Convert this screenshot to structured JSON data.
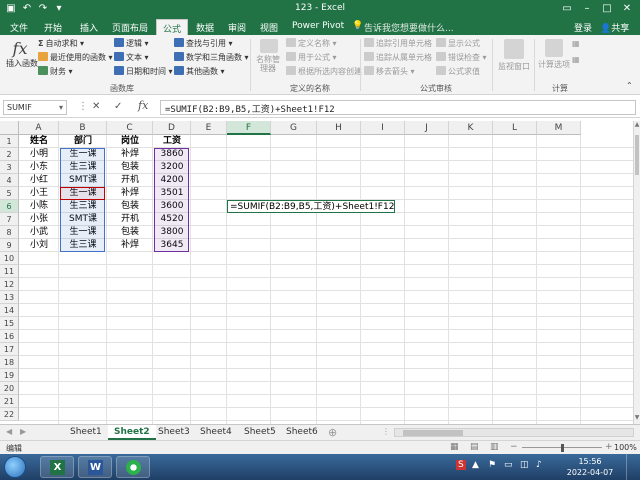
{
  "window": {
    "title": "123 - Excel"
  },
  "tabs": [
    "文件",
    "开始",
    "插入",
    "页面布局",
    "公式",
    "数据",
    "审阅",
    "视图",
    "Power Pivot"
  ],
  "active_tab": "公式",
  "tell_me": "告诉我您想要做什么...",
  "account": {
    "login": "登录",
    "share": "共享"
  },
  "ribbon": {
    "insert_function": "插入函数",
    "autosum": "自动求和",
    "recent": "最近使用的函数",
    "financial": "财务",
    "logical": "逻辑",
    "text": "文本",
    "datetime": "日期和时间",
    "lookup": "查找与引用",
    "math": "数学和三角函数",
    "more": "其他函数",
    "group_library": "函数库",
    "name_manager": "名称管理器",
    "define_name": "定义名称",
    "use_in_formula": "用于公式",
    "create_from_sel": "根据所选内容创建",
    "group_names": "定义的名称",
    "trace_precedents": "追踪引用单元格",
    "trace_dependents": "追踪从属单元格",
    "remove_arrows": "移去箭头",
    "show_formulas": "显示公式",
    "error_check": "错误检查",
    "evaluate": "公式求值",
    "group_audit": "公式审核",
    "watch": "监视窗口",
    "calc_options": "计算选项",
    "group_calc": "计算"
  },
  "formula_bar": {
    "name_box": "SUMIF",
    "formula": "=SUMIF(B2:B9,B5,工资)+Sheet1!F12"
  },
  "columns": [
    "A",
    "B",
    "C",
    "D",
    "E",
    "F",
    "G",
    "H",
    "I",
    "J",
    "K",
    "L",
    "M"
  ],
  "rows": [
    "1",
    "2",
    "3",
    "4",
    "5",
    "6",
    "7",
    "8",
    "9",
    "10",
    "11",
    "12",
    "13",
    "14",
    "15",
    "16",
    "17",
    "18",
    "19",
    "20",
    "21",
    "22"
  ],
  "table": {
    "headers": [
      "姓名",
      "部门",
      "岗位",
      "工资"
    ],
    "rows": [
      [
        "小明",
        "生一课",
        "补焊",
        "3860"
      ],
      [
        "小东",
        "生三课",
        "包装",
        "3200"
      ],
      [
        "小红",
        "SMT课",
        "开机",
        "4200"
      ],
      [
        "小王",
        "生一课",
        "补焊",
        "3501"
      ],
      [
        "小陈",
        "生三课",
        "包装",
        "3600"
      ],
      [
        "小张",
        "SMT课",
        "开机",
        "4520"
      ],
      [
        "小武",
        "生一课",
        "包装",
        "3800"
      ],
      [
        "小刘",
        "生三课",
        "补焊",
        "3645"
      ]
    ]
  },
  "editing_cell": "=SUMIF(B2:B9,B5,工资)+Sheet1!F12",
  "sheets": [
    "Sheet1",
    "Sheet2",
    "Sheet3",
    "Sheet4",
    "Sheet5",
    "Sheet6"
  ],
  "active_sheet": "Sheet2",
  "status": {
    "mode": "编辑",
    "zoom": "100%"
  },
  "clock": {
    "time": "15:56",
    "date": "2022-04-07"
  },
  "colors": {
    "excel_green": "#217346",
    "ref_blue": "#4472c4",
    "ref_red": "#c00000",
    "ref_purple": "#7030a0"
  }
}
